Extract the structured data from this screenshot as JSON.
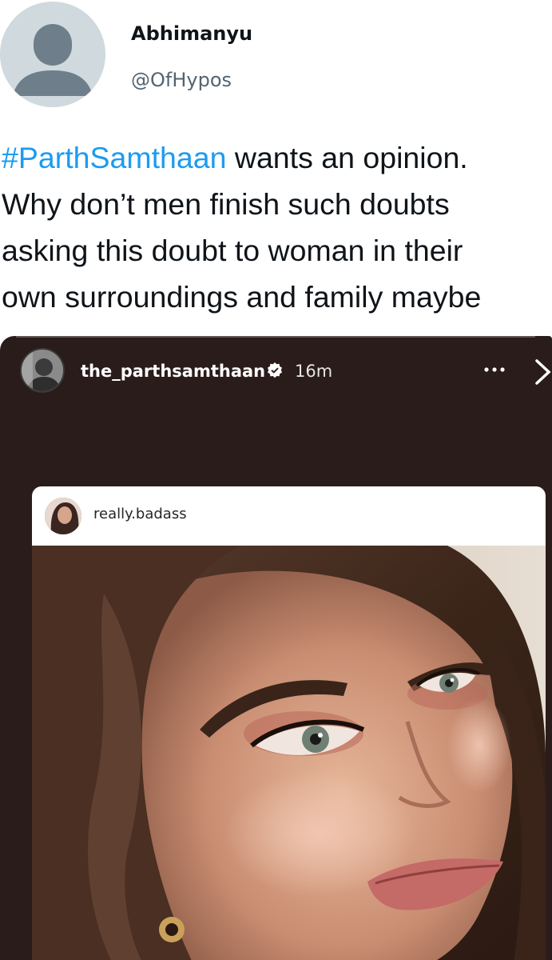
{
  "tweet": {
    "display_name": "Abhimanyu",
    "handle": "@OfHypos",
    "avatar_icon": "default-profile-avatar-icon",
    "text_lines": [
      {
        "hashtag": "#ParthSamthaan",
        "rest": " wants an opinion."
      },
      {
        "hashtag": "",
        "rest": "Why don’t men finish such doubts"
      },
      {
        "hashtag": "",
        "rest": "asking this doubt to woman in their"
      },
      {
        "hashtag": "",
        "rest": "own surroundings and family maybe"
      }
    ],
    "hashtag_color": "#1d9bf0"
  },
  "story": {
    "username": "the_parthsamthaan",
    "time": "16m",
    "verified_icon": "verified-badge-icon",
    "more_icon": "more-horizontal-icon",
    "close_icon": "chevron-right-icon",
    "shared_post": {
      "username": "really.badass",
      "photo": "woman-portrait-closeup"
    }
  },
  "colors": {
    "story_background": "#2a1c1a",
    "text_primary": "#0f1419",
    "text_secondary": "#536471"
  }
}
